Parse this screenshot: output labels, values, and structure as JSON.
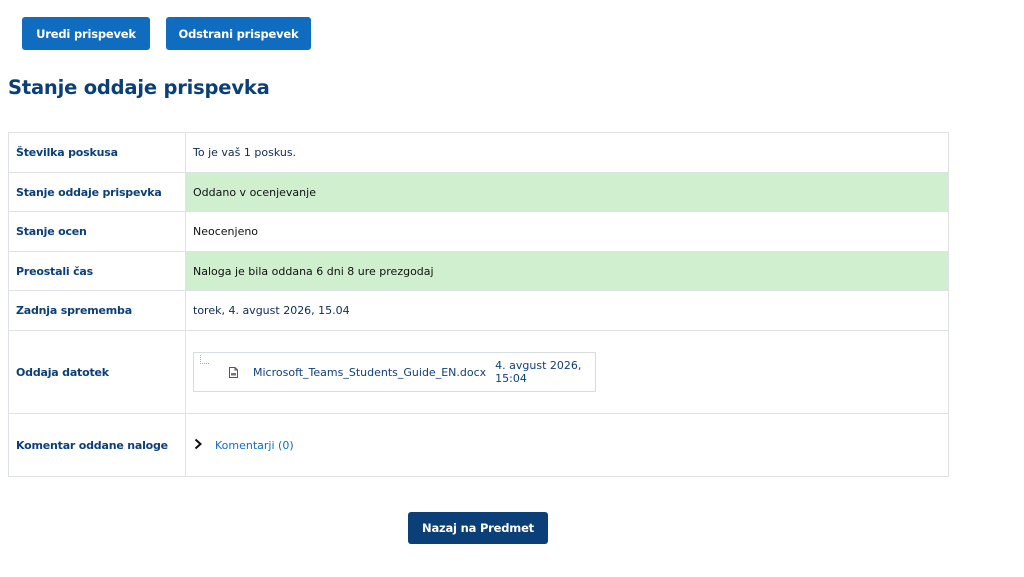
{
  "actions": {
    "edit_label": "Uredi prispevek",
    "remove_label": "Odstrani prispevek"
  },
  "section_title": "Stanje oddaje prispevka",
  "status_rows": [
    {
      "label": "Številka poskusa",
      "value": "To je vaš 1 poskus."
    },
    {
      "label": "Stanje oddaje prispevka",
      "value": "Oddano v ocenjevanje"
    },
    {
      "label": "Stanje ocen",
      "value": "Neocenjeno"
    },
    {
      "label": "Preostali čas",
      "value": "Naloga je bila oddana 6 dni 8 ure prezgodaj"
    },
    {
      "label": "Zadnja sprememba",
      "value": "torek, 4. avgust 2026, 15.04"
    },
    {
      "label": "Oddaja datotek"
    },
    {
      "label": "Komentar oddane naloge"
    }
  ],
  "file": {
    "name": "Microsoft_Teams_Students_Guide_EN.docx",
    "date": "4. avgust 2026, 15:04",
    "icon": "document-icon"
  },
  "comments": {
    "label": "Komentarji (0)",
    "icon": "chevron-right-icon"
  },
  "back_button_label": "Nazaj na Predmet",
  "colors": {
    "primary": "#0f6cbf",
    "dark_primary": "#0b3f78",
    "success_bg": "#cfefcf"
  }
}
